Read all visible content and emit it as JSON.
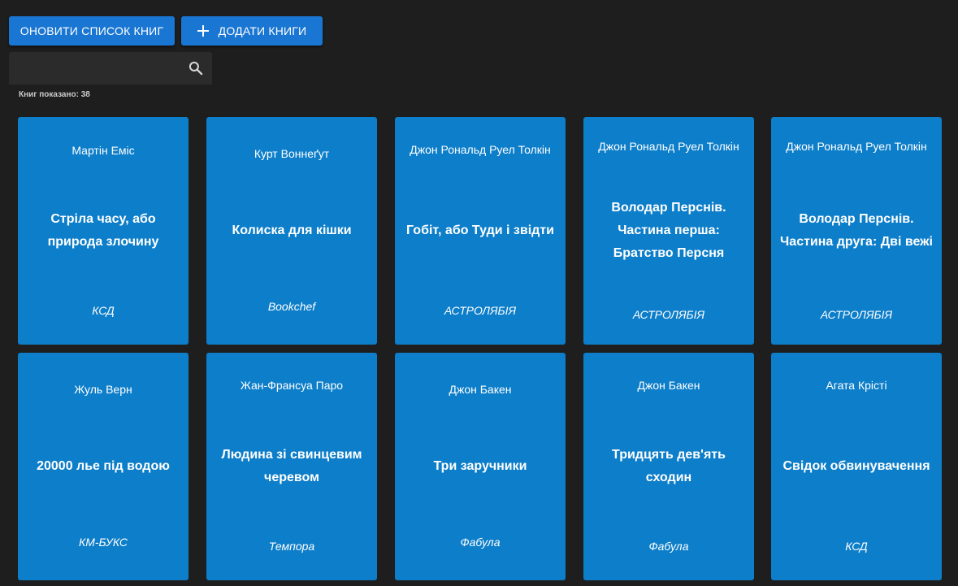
{
  "toolbar": {
    "refresh_label": "ОНОВИТИ СПИСОК КНИГ",
    "add_label": "ДОДАТИ КНИГИ"
  },
  "search": {
    "value": "",
    "placeholder": ""
  },
  "count": {
    "label": "Книг показано:",
    "value": "38"
  },
  "books": [
    {
      "author": "Мартін Еміс",
      "title": "Стріла часу, або природа злочину",
      "publisher": "КСД"
    },
    {
      "author": "Курт Воннеґут",
      "title": "Колиска для кішки",
      "publisher": "Bookchef"
    },
    {
      "author": "Джон Рональд Руел Толкін",
      "title": "Гобіт, або Туди і звідти",
      "publisher": "АСТРОЛЯБІЯ"
    },
    {
      "author": "Джон Рональд Руел Толкін",
      "title": "Володар Перснів. Частина перша: Братство Персня",
      "publisher": "АСТРОЛЯБІЯ"
    },
    {
      "author": "Джон Рональд Руел Толкін",
      "title": "Володар Перснів. Частина друга: Дві вежі",
      "publisher": "АСТРОЛЯБІЯ"
    },
    {
      "author": "Жуль Верн",
      "title": "20000 лье під водою",
      "publisher": "КМ-БУКС"
    },
    {
      "author": "Жан-Франсуа Паро",
      "title": "Людина зі свинцевим черевом",
      "publisher": "Темпора"
    },
    {
      "author": "Джон Бакен",
      "title": "Три заручники",
      "publisher": "Фабула"
    },
    {
      "author": "Джон Бакен",
      "title": "Тридцять дев'ять сходин",
      "publisher": "Фабула"
    },
    {
      "author": "Агата Крісті",
      "title": "Свідок обвинувачення",
      "publisher": "КСД"
    }
  ],
  "colors": {
    "background": "#1e1e1e",
    "button": "#1976d2",
    "card": "#0d7ec9",
    "search_bg": "#2b2b2b"
  }
}
